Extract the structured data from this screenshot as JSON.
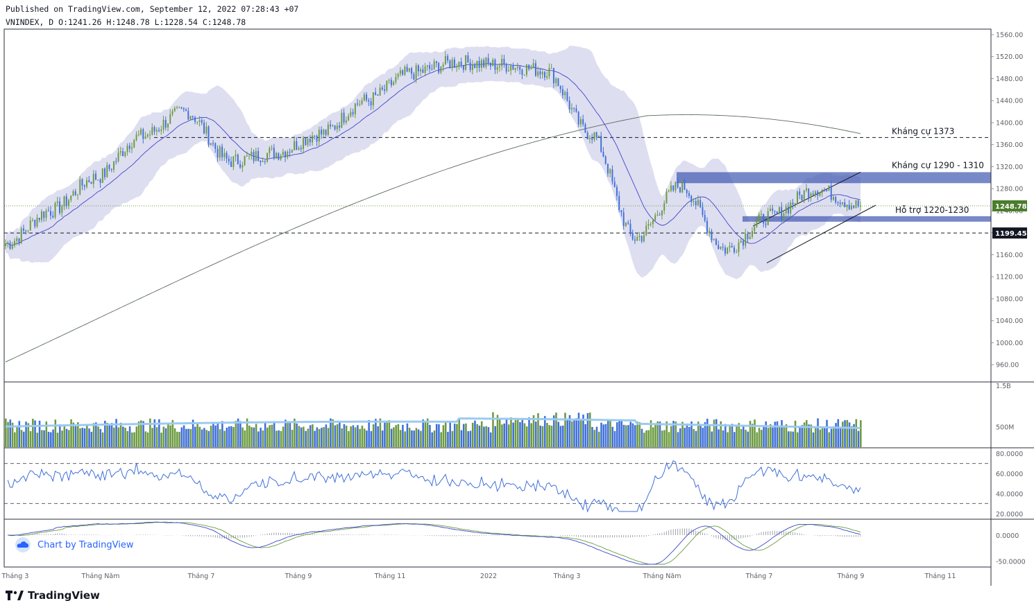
{
  "header": {
    "published": "Published on TradingView.com, September 12, 2022 07:28:43 +07",
    "ohlc": "VNINDEX, D O:1241.26 H:1248.78 L:1228.54 C:1248.78"
  },
  "watermark": {
    "label": "Chart by TradingView",
    "icon": "cloud-icon"
  },
  "footer": {
    "logo_icon": "tradingview-logo-icon",
    "brand": "TradingView"
  },
  "colors": {
    "up": "#6b9a3f",
    "down": "#3f6fd8",
    "band": "#d8d8ee",
    "ma20": "#3b45c8",
    "ma200": "#5a6a5a",
    "zone": "#3f57b0",
    "vol_ma": "#9cc9f0",
    "rsi": "#3f6fd8"
  },
  "chart_data": [
    {
      "type": "candlestick",
      "title": "VNINDEX, D",
      "x": [
        "2021-03-01",
        "2021-04-01",
        "2021-05-01",
        "2021-06-01",
        "2021-07-01",
        "2021-08-01",
        "2021-09-01",
        "2021-10-01",
        "2021-11-01",
        "2021-12-01",
        "2022-01-01",
        "2022-02-01",
        "2022-03-01",
        "2022-04-01",
        "2022-05-01",
        "2022-06-01",
        "2022-07-01",
        "2022-08-01",
        "2022-09-01",
        "2022-09-09"
      ],
      "close": [
        1180,
        1240,
        1300,
        1375,
        1420,
        1330,
        1345,
        1380,
        1440,
        1490,
        1510,
        1505,
        1495,
        1380,
        1190,
        1285,
        1170,
        1230,
        1280,
        1248.78
      ],
      "ylim": [
        930,
        1570
      ],
      "yticks": [
        "1560.00",
        "1520.00",
        "1480.00",
        "1440.00",
        "1400.00",
        "1360.00",
        "1320.00",
        "1280.00",
        "1240.00",
        "1200.00",
        "1160.00",
        "1120.00",
        "1080.00",
        "1040.00",
        "1000.00",
        "960.00"
      ],
      "xticks": [
        "Tháng 3",
        "Tháng Năm",
        "Tháng 7",
        "Tháng 9",
        "Tháng 11",
        "2022",
        "Tháng 3",
        "Tháng Năm",
        "Tháng 7",
        "Tháng 9",
        "Tháng 11"
      ],
      "price_labels": [
        {
          "text": "1248.78"
        },
        {
          "text": "1199.45"
        }
      ],
      "annotations": [
        {
          "text": "Kháng cự 1373",
          "level": 1373
        },
        {
          "text": "Kháng cự 1290 - 1310",
          "range": [
            1290,
            1310
          ]
        },
        {
          "text": "Hỗ trợ 1220-1230",
          "range": [
            1220,
            1230
          ]
        }
      ],
      "dashed_levels": [
        1373,
        1199.45
      ],
      "ma200": {
        "start": 965,
        "end": 1310
      },
      "channel": {
        "lower": [
          1145,
          1250
        ],
        "upper": [
          1212,
          1310
        ]
      }
    },
    {
      "type": "bar",
      "title": "Volume",
      "yticks": [
        "1.5B",
        "500M"
      ],
      "ylim": [
        0,
        1.5
      ]
    },
    {
      "type": "line",
      "title": "RSI",
      "yticks": [
        "80.0000",
        "60.0000",
        "40.0000",
        "20.0000"
      ],
      "levels": [
        70,
        30
      ],
      "last": 46
    },
    {
      "type": "line",
      "title": "MACD",
      "yticks": [
        "0.0000",
        "-50.0000"
      ]
    }
  ]
}
